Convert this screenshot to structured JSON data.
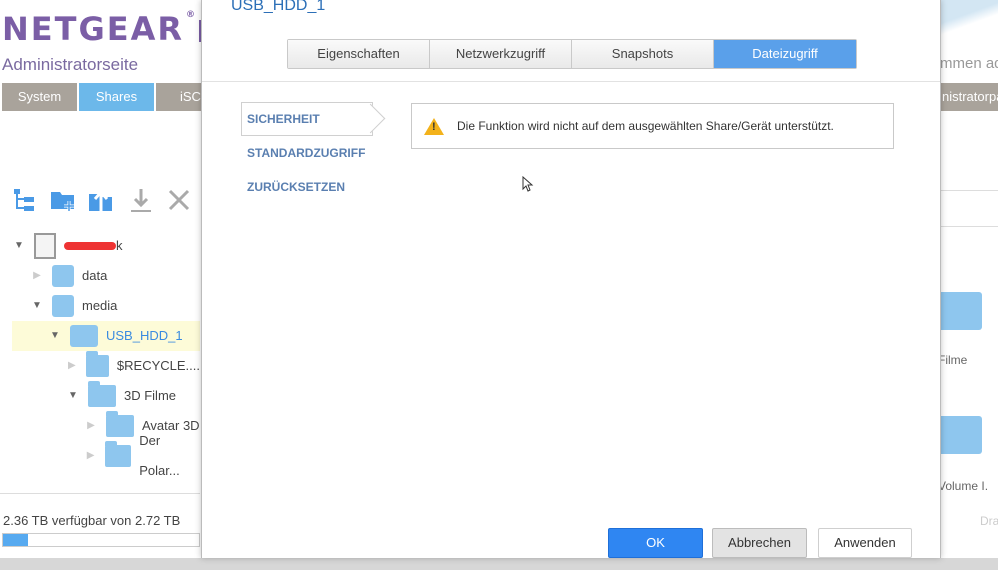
{
  "app": {
    "brand": "NETGEAR",
    "brand_mark": "®",
    "subtitle": "Administratorseite",
    "nav_tabs": [
      {
        "label": "System"
      },
      {
        "label": "Shares"
      },
      {
        "label": "iSCS"
      }
    ],
    "right_partial_text_1": "mmen ad",
    "right_partial_tab": "nistratorpa",
    "tree": [
      {
        "label": "k"
      },
      {
        "label": "data"
      },
      {
        "label": "media"
      },
      {
        "label": "USB_HDD_1"
      },
      {
        "label": "$RECYCLE...."
      },
      {
        "label": "3D Filme"
      },
      {
        "label": "Avatar 3D"
      },
      {
        "label": "Der Polar..."
      }
    ],
    "storage_text": "2.36 TB verfügbar von 2.72 TB",
    "storage_used_fraction": 0.13,
    "right_items": [
      {
        "label": "Filme"
      },
      {
        "label": "Volume I."
      },
      {
        "label": "Dra"
      }
    ]
  },
  "dialog": {
    "title": "USB_HDD_1",
    "tabs": [
      {
        "label": "Eigenschaften"
      },
      {
        "label": "Netzwerkzugriff"
      },
      {
        "label": "Snapshots"
      },
      {
        "label": "Dateizugriff"
      }
    ],
    "side_nav": [
      {
        "label": "SICHERHEIT"
      },
      {
        "label": "STANDARDZUGRIFF"
      },
      {
        "label": "ZURÜCKSETZEN"
      }
    ],
    "notice": {
      "icon_glyph": "!",
      "text": "Die Funktion wird nicht auf dem ausgewählten Share/Gerät unterstützt."
    },
    "buttons": {
      "ok": "OK",
      "cancel": "Abbrechen",
      "apply": "Anwenden"
    }
  }
}
